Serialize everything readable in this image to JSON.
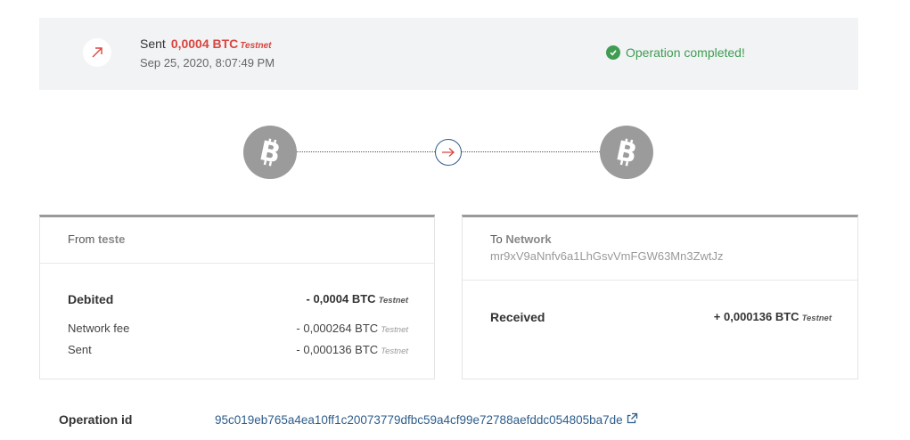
{
  "header": {
    "direction_label": "Sent",
    "amount": "0,0004 BTC",
    "network_badge": "Testnet",
    "date": "Sep 25, 2020, 8:07:49 PM",
    "status": "Operation completed!"
  },
  "colors": {
    "accent_red": "#d9453e",
    "success_green": "#3f9c52",
    "link_blue": "#2e5d8a",
    "coin_grey": "#9b9b9b"
  },
  "icons": {
    "direction": "arrow-up-right-icon",
    "status": "check-circle-icon",
    "coin": "bitcoin-icon",
    "transfer": "arrow-right-icon",
    "external": "external-link-icon"
  },
  "from_card": {
    "prefix": "From",
    "account": "teste",
    "rows": [
      {
        "label": "Debited",
        "value": "- 0,0004 BTC",
        "badge": "Testnet"
      },
      {
        "label": "Network fee",
        "value": "- 0,000264 BTC",
        "badge": "Testnet"
      },
      {
        "label": "Sent",
        "value": "- 0,000136 BTC",
        "badge": "Testnet"
      }
    ]
  },
  "to_card": {
    "prefix": "To",
    "account": "Network",
    "address": "mr9xV9aNnfv6a1LhGsvVmFGW63Mn3ZwtJz",
    "rows": [
      {
        "label": "Received",
        "value": "+ 0,000136 BTC",
        "badge": "Testnet"
      }
    ]
  },
  "operation": {
    "label": "Operation id",
    "id": "95c019eb765a4ea10ff1c20073779dfbc59a4cf99e72788aefddc054805ba7de"
  }
}
